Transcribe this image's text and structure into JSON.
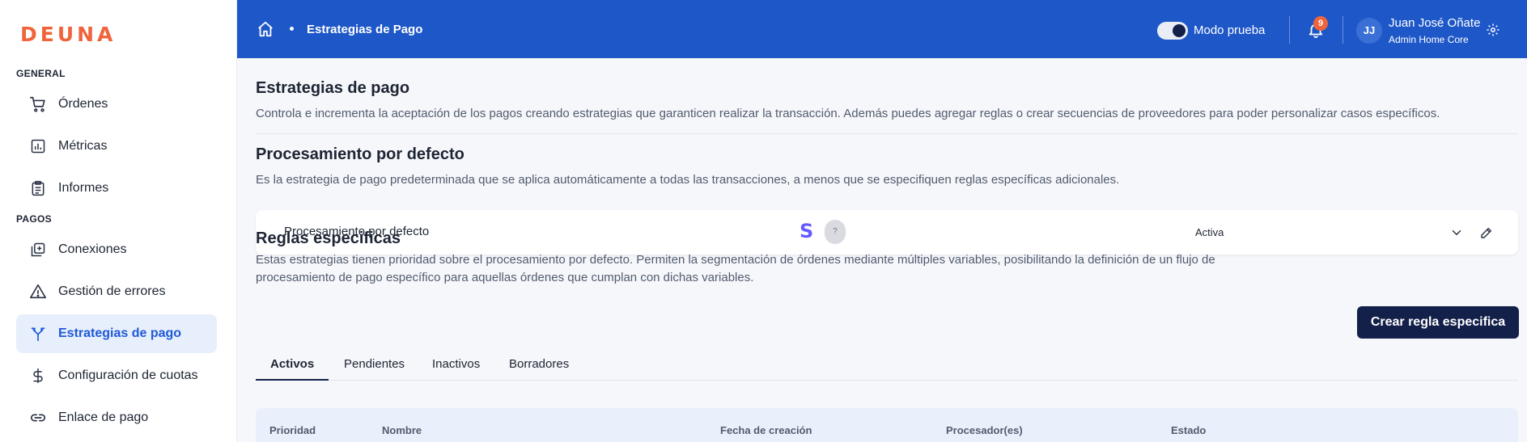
{
  "brand": {
    "logo_text": "DEUNA",
    "accent": "#f0643c",
    "primary": "#1e57c8",
    "dark": "#13204a"
  },
  "sidebar": {
    "sections": [
      {
        "label": "GENERAL"
      },
      {
        "label": "PAGOS"
      }
    ],
    "items": [
      {
        "label": "Órdenes",
        "icon": "cart-icon"
      },
      {
        "label": "Métricas",
        "icon": "chart-icon"
      },
      {
        "label": "Informes",
        "icon": "clipboard-icon"
      },
      {
        "label": "Conexiones",
        "icon": "connections-icon"
      },
      {
        "label": "Gestión de errores",
        "icon": "warning-icon"
      },
      {
        "label": "Estrategias de pago",
        "icon": "fork-icon",
        "active": true
      },
      {
        "label": "Configuración de cuotas",
        "icon": "dollar-icon"
      },
      {
        "label": "Enlace de pago",
        "icon": "link-icon"
      }
    ]
  },
  "topbar": {
    "breadcrumb_title": "Estrategias de Pago",
    "test_mode_label": "Modo prueba",
    "test_mode_on": true,
    "notifications_count": "9",
    "user": {
      "initials": "JJ",
      "name": "Juan José Oñate",
      "role": "Admin Home Core"
    }
  },
  "main": {
    "title": "Estrategias de pago",
    "description": "Controla e incrementa la aceptación de los pagos creando estrategias que garanticen realizar la transacción. Además puedes agregar reglas o crear secuencias de proveedores para poder personalizar casos específicos.",
    "default_section": {
      "title": "Procesamiento por defecto",
      "description": "Es la estrategia de pago predeterminada que se aplica automáticamente a todas las transacciones, a menos que se especifiquen reglas específicas adicionales.",
      "card": {
        "name": "Procesamiento por defecto",
        "processor_logo": "S",
        "unknown_processor": "?",
        "status": "Activa"
      }
    },
    "rules_section": {
      "title": "Reglas especificas",
      "description_line1": "Estas estrategias tienen prioridad sobre el procesamiento por defecto. Permiten la segmentación de órdenes mediante múltiples variables, posibilitando la definición de un flujo de",
      "description_line2": "procesamiento de pago específico para aquellas órdenes que cumplan con dichas variables.",
      "create_button": "Crear regla especifica",
      "tabs": [
        "Activos",
        "Pendientes",
        "Inactivos",
        "Borradores"
      ],
      "table_headers": [
        "Prioridad",
        "Nombre",
        "Fecha de creación",
        "Procesador(es)",
        "Estado"
      ]
    }
  }
}
